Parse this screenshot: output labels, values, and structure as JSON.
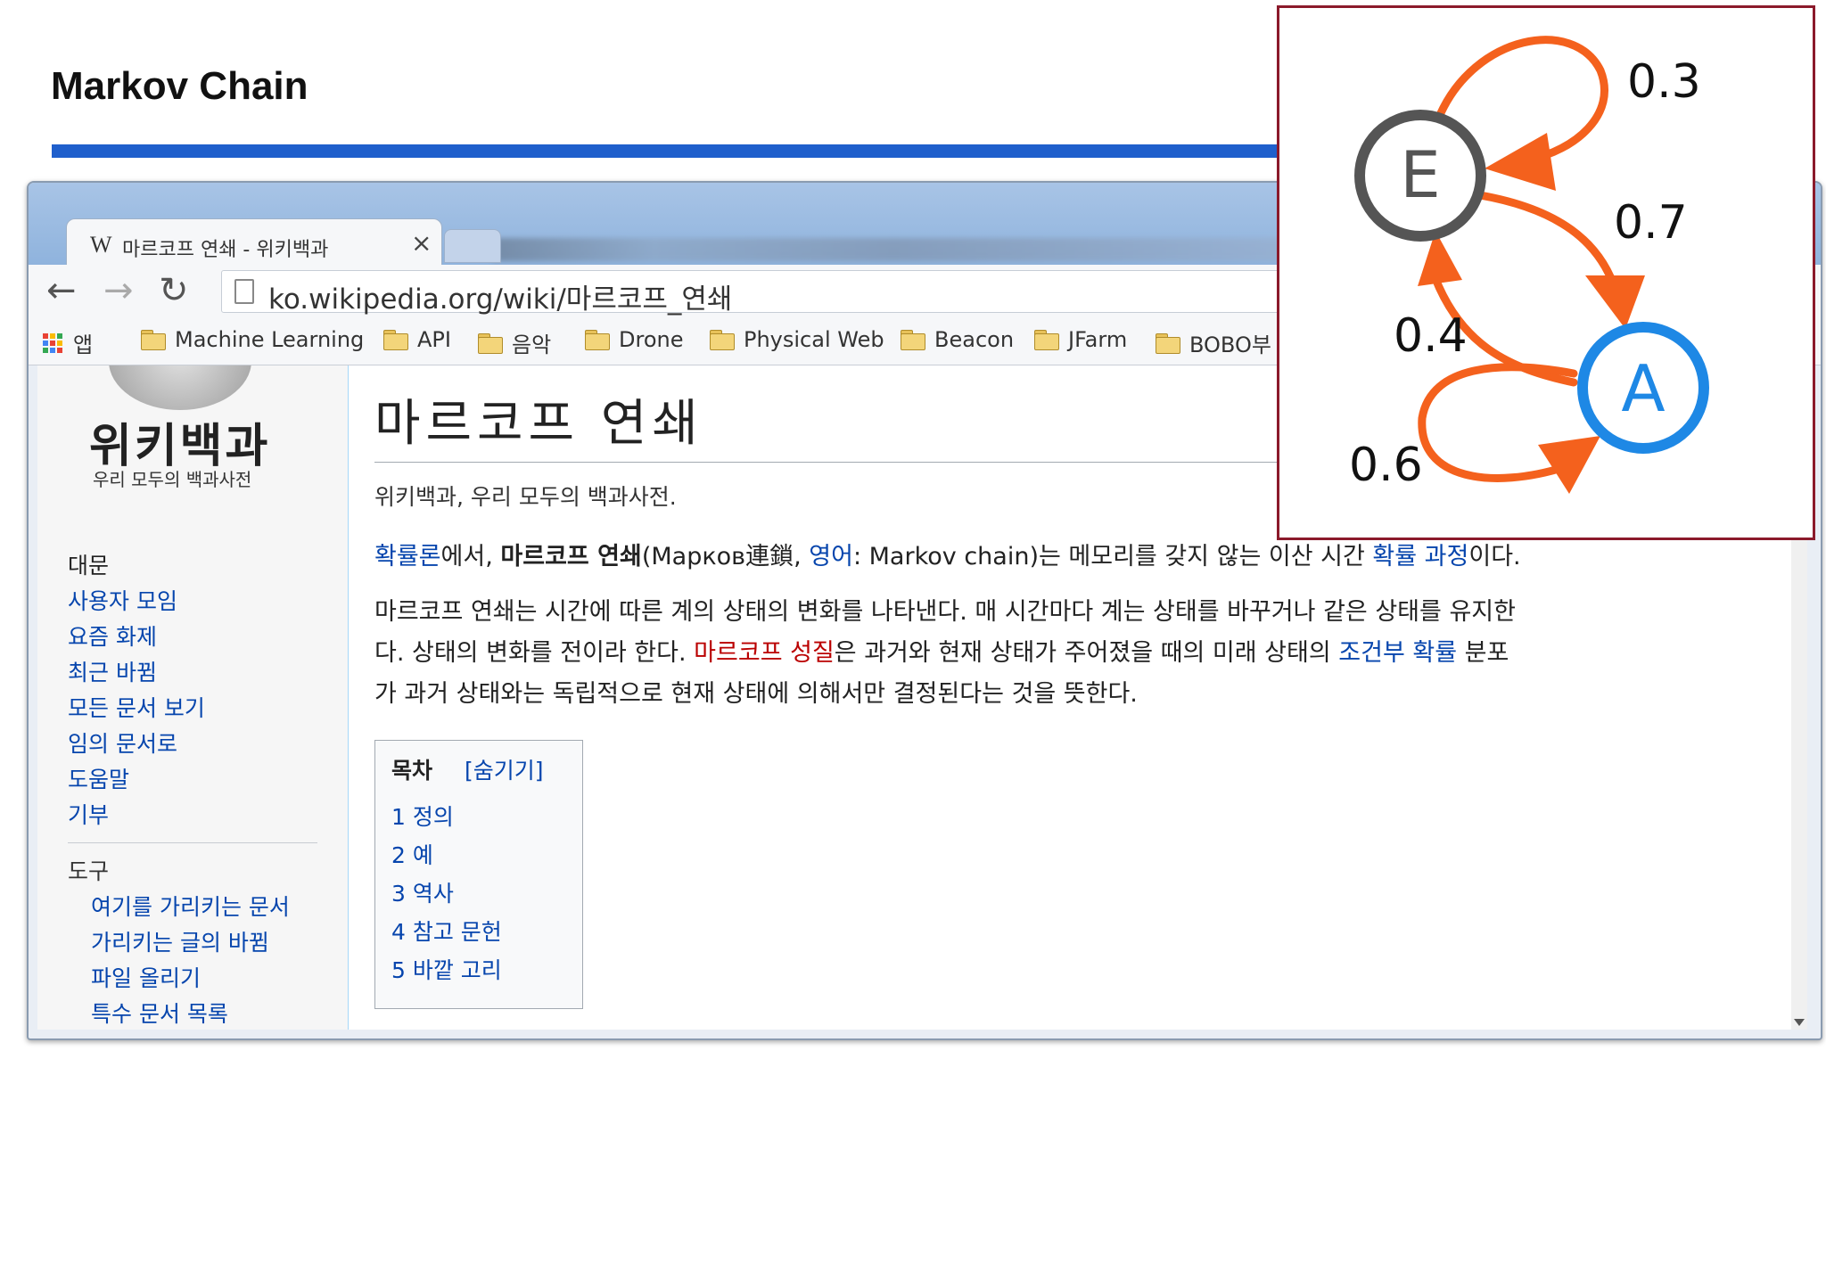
{
  "slide": {
    "title": "Markov Chain"
  },
  "browser": {
    "tab_icon": "W",
    "tab_title": "마르코프 연쇄 - 위키백과",
    "tab_close": "×",
    "url": "ko.wikipedia.org/wiki/마르코프_연쇄",
    "bookmarks": [
      {
        "label": "앱",
        "icon": "apps-icon"
      },
      {
        "label": "Machine Learning",
        "icon": "folder-icon"
      },
      {
        "label": "API",
        "icon": "folder-icon"
      },
      {
        "label": "음악",
        "icon": "folder-icon"
      },
      {
        "label": "Drone",
        "icon": "folder-icon"
      },
      {
        "label": "Physical Web",
        "icon": "folder-icon"
      },
      {
        "label": "Beacon",
        "icon": "folder-icon"
      },
      {
        "label": "JFarm",
        "icon": "folder-icon"
      },
      {
        "label": "BOBO부",
        "icon": "folder-icon"
      }
    ]
  },
  "wiki": {
    "logo": "위키백과",
    "tagline": "우리 모두의 백과사전",
    "nav": [
      "대문",
      "사용자 모임",
      "요즘 화제",
      "최근 바뀜",
      "모든 문서 보기",
      "임의 문서로",
      "도움말",
      "기부"
    ],
    "tools_heading": "도구",
    "tools": [
      "여기를 가리키는 문서",
      "가리키는 글의 바뀜",
      "파일 올리기",
      "특수 문서 목록"
    ]
  },
  "article": {
    "title": "마르코프 연쇄",
    "subtitle": "위키백과, 우리 모두의 백과사전.",
    "p1": {
      "link1": "확률론",
      "t1": "에서, ",
      "bold": "마르코프 연쇄",
      "t2": "(Марков連鎖, ",
      "link2": "영어",
      "t3": ": Markov chain)는 메모리를 갖지 않는 이산 시간 ",
      "link3": "확률 과정",
      "t4": "이다."
    },
    "p2_line1": "마르코프 연쇄는 시간에 따른 계의 상태의 변화를 나타낸다. 매 시간마다 계는 상태를 바꾸거나 같은 상태를 유지한",
    "p2_line2": {
      "t1": "다. 상태의 변화를 전이라 한다. ",
      "redlink": "마르코프 성질",
      "t2": "은 과거와 현재 상태가 주어졌을 때의 미래 상태의 ",
      "link": "조건부 확률",
      "t3": " 분포"
    },
    "p2_line3": "가 과거 상태와는 독립적으로 현재 상태에 의해서만 결정된다는 것을 뜻한다.",
    "toc": {
      "title": "목차",
      "hide": "[숨기기]",
      "items": [
        "1 정의",
        "2 예",
        "3 역사",
        "4 참고 문헌",
        "5 바깥 고리"
      ]
    }
  },
  "diagram": {
    "states": [
      {
        "label": "E",
        "color": "#555555"
      },
      {
        "label": "A",
        "color": "#1e88e5"
      }
    ],
    "edge_color": "#f4611d",
    "transitions": [
      {
        "from": "E",
        "to": "E",
        "p": "0.3"
      },
      {
        "from": "E",
        "to": "A",
        "p": "0.7"
      },
      {
        "from": "A",
        "to": "E",
        "p": "0.4"
      },
      {
        "from": "A",
        "to": "A",
        "p": "0.6"
      }
    ]
  }
}
